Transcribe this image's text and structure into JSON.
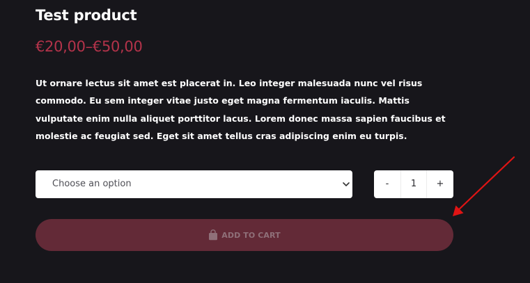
{
  "product": {
    "title": "Test product",
    "price": "€20,00–€50,00",
    "description": "Ut ornare lectus sit amet est placerat in. Leo integer malesuada nunc vel risus commodo. Eu sem integer vitae justo eget magna fermentum iaculis. Mattis vulputate enim nulla aliquet porttitor lacus. Lorem donec massa sapien faucibus et molestie ac feugiat sed. Eget sit amet tellus cras adipiscing enim eu turpis."
  },
  "variation": {
    "selected": "Choose an option"
  },
  "quantity": {
    "minus": "-",
    "value": "1",
    "plus": "+"
  },
  "cart": {
    "label": "ADD TO CART",
    "icon": "shopping-bag-icon"
  },
  "annotation": {
    "icon": "arrow-annotation-icon"
  },
  "colors": {
    "background": "#17161b",
    "price": "#b3334a",
    "cart_button": "#632a37",
    "arrow": "#e01414"
  }
}
